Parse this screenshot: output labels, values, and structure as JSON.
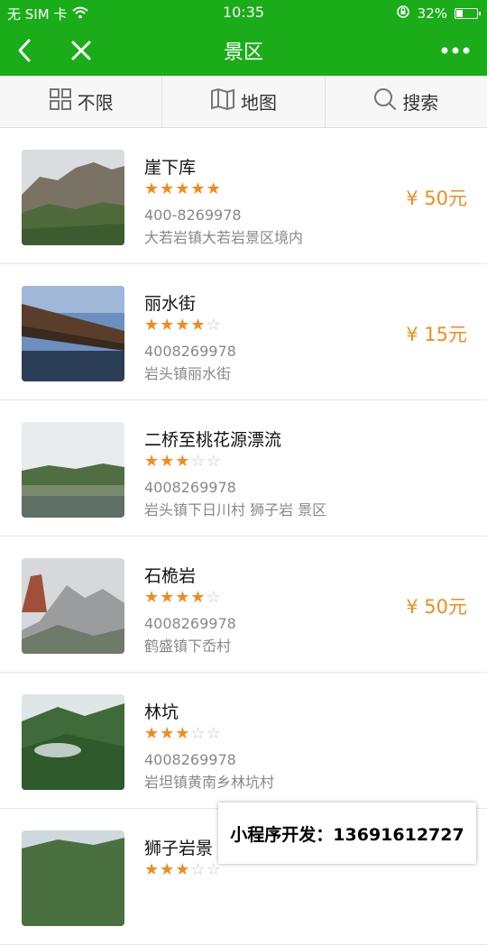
{
  "status_bar": {
    "carrier": "无 SIM 卡",
    "time": "10:35",
    "battery": "32%",
    "battery_level": 0.32
  },
  "nav": {
    "title": "景区"
  },
  "filters": [
    {
      "label": "不限",
      "icon": "grid-icon"
    },
    {
      "label": "地图",
      "icon": "map-icon"
    },
    {
      "label": "搜索",
      "icon": "search-icon"
    }
  ],
  "items": [
    {
      "name": "崖下库",
      "rating": 5,
      "phone": "400-8269978",
      "address": "大若岩镇大若岩景区境内",
      "price": "¥ 50元"
    },
    {
      "name": "丽水街",
      "rating": 4,
      "phone": "4008269978",
      "address": "岩头镇丽水街",
      "price": "¥ 15元"
    },
    {
      "name": "二桥至桃花源漂流",
      "rating": 3,
      "phone": "4008269978",
      "address": "岩头镇下日川村 狮子岩 景区",
      "price": ""
    },
    {
      "name": "石桅岩",
      "rating": 4,
      "phone": "4008269978",
      "address": "鹤盛镇下岙村",
      "price": "¥ 50元"
    },
    {
      "name": "林坑",
      "rating": 3,
      "phone": "4008269978",
      "address": "岩坦镇黄南乡林坑村",
      "price": ""
    },
    {
      "name": "狮子岩景",
      "rating": 3,
      "phone": "",
      "address": "",
      "price": ""
    }
  ],
  "watermark": {
    "text": "小程序开发：13691612727"
  },
  "colors": {
    "header": "#1aad19",
    "accent": "#f08c1e"
  }
}
